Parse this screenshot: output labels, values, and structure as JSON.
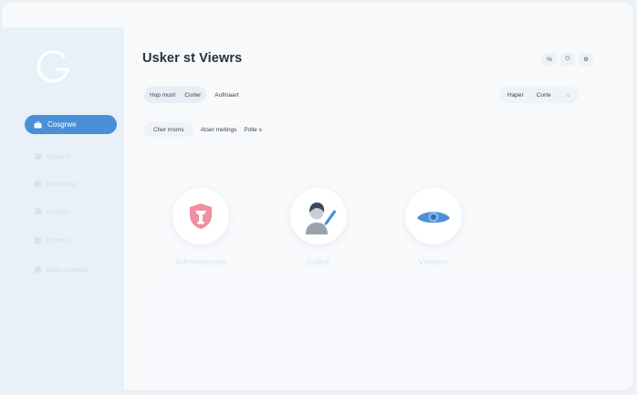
{
  "sidebar": {
    "logo_letter": "G",
    "active_item": {
      "label": "Cosgrwe",
      "icon": "briefcase-icon"
    },
    "items": [
      {
        "label": "Gsnens",
        "icon": "user-icon"
      },
      {
        "label": "Amnndng",
        "icon": "gear-icon"
      },
      {
        "label": "Cnogas",
        "icon": "user-icon"
      },
      {
        "label": "Cslsors",
        "icon": "clock-icon"
      },
      {
        "label": "Baag ssmagn",
        "icon": "gear-icon"
      }
    ]
  },
  "header": {
    "title": "Usker st Viewrs",
    "icons": [
      "translate-icon",
      "lock-icon",
      "settings-icon"
    ],
    "icon_glyphs": [
      "%",
      "⏻",
      "⚙"
    ]
  },
  "filters": {
    "group": [
      "Hop munt",
      "Corter"
    ],
    "plain": "Aufmaart",
    "right_label": "Haper",
    "right_value": "Corte",
    "row2_chip": "Cher rnsms",
    "row2_items": [
      "Atser metings",
      "Polle s"
    ]
  },
  "roles": [
    {
      "label": "Administrator",
      "icon": "shield-icon"
    },
    {
      "label": "Editor",
      "icon": "editor-person-icon"
    },
    {
      "label": "Viewers",
      "icon": "eye-icon"
    }
  ],
  "colors": {
    "accent": "#4a90d9",
    "sidebar_bg": "#e7f1f7",
    "shield": "#f08fa0",
    "eye": "#4a90d9"
  }
}
